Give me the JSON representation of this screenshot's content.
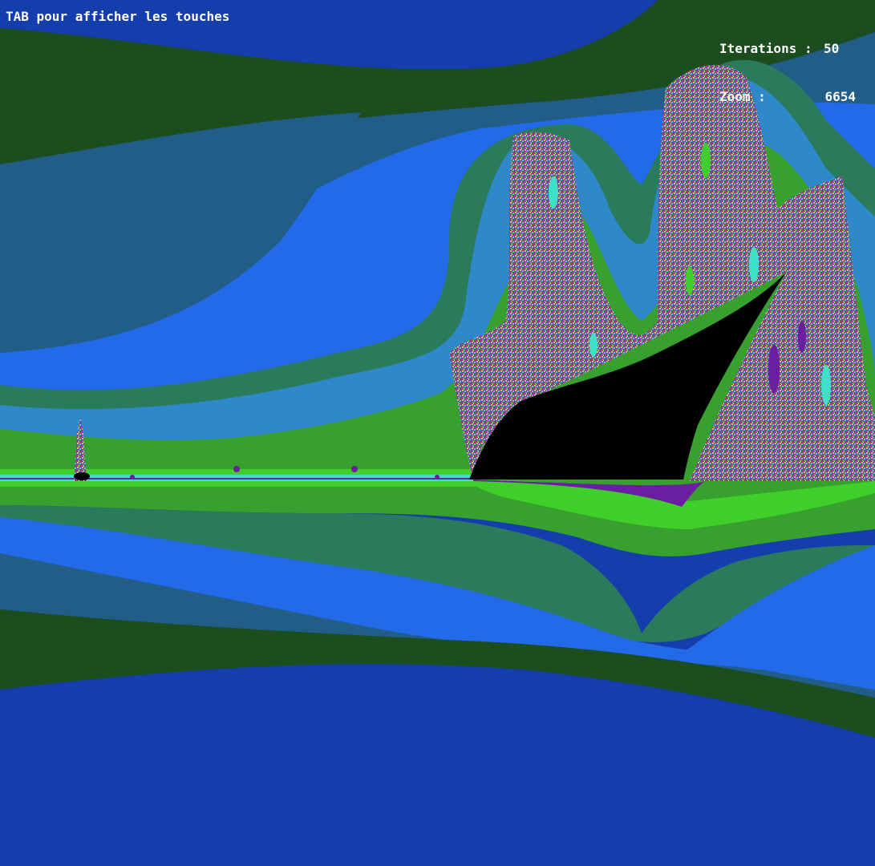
{
  "hud": {
    "help_hint": "TAB pour afficher les touches",
    "iterations_label": "Iterations :",
    "iterations_value": "50",
    "zoom_label": "Zoom :",
    "zoom_value": "6654"
  },
  "palette": {
    "deep_blue": "#153ead",
    "dark_green": "#1b4d1f",
    "slate_blue": "#215d87",
    "bright_blue": "#226ae8",
    "teal_green": "#2a7a5c",
    "sky_blue": "#2f88c9",
    "green": "#37a02f",
    "lime": "#3fce2a",
    "cyan": "#3fe0c8",
    "purple": "#6a1fa0",
    "black": "#000000"
  }
}
